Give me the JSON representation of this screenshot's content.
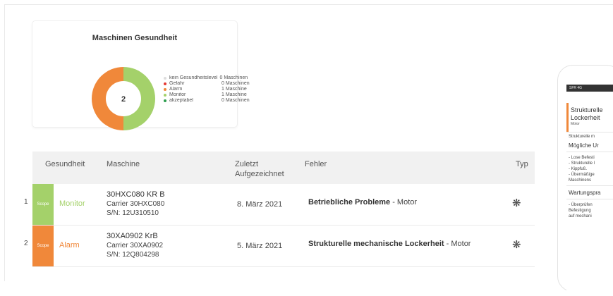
{
  "health_card": {
    "title": "Maschinen Gesundheit",
    "center_value": "2",
    "colors": {
      "alarm": "#f0883a",
      "monitor": "#a4d16a",
      "danger": "#e53935",
      "acceptable": "#2e9e4f",
      "none": "#dddddd"
    },
    "legend": [
      {
        "label": "kein Gesundheitslevel",
        "value": "0 Maschinen",
        "color": "#dddddd"
      },
      {
        "label": "Gefahr",
        "value": "0 Maschinen",
        "color": "#e53935"
      },
      {
        "label": "Alarm",
        "value": "1 Maschine",
        "color": "#f0883a"
      },
      {
        "label": "Monitor",
        "value": "1 Maschine",
        "color": "#a4d16a"
      },
      {
        "label": "akzeptabel",
        "value": "0 Maschinen",
        "color": "#2e9e4f"
      }
    ],
    "donut_split": {
      "alarm": 1,
      "monitor": 1
    }
  },
  "table": {
    "headers": {
      "health": "Gesundheit",
      "machine": "Maschine",
      "last_recorded_1": "Zuletzt",
      "last_recorded_2": "Aufgezeichnet",
      "fault": "Fehler",
      "type": "Typ"
    },
    "rows": [
      {
        "num": "1",
        "scope": "Scope",
        "status": "Monitor",
        "status_color": "#a4d16a",
        "machine_name": "30HXC080 KR B",
        "carrier": "Carrier  30HXC080",
        "serial": "S/N: 12U310510",
        "date": "8. März 2021",
        "fault_bold": "Betriebliche Probleme",
        "fault_rest": " - Motor",
        "type_icon": "snowflake-icon"
      },
      {
        "num": "2",
        "scope": "Scope",
        "status": "Alarm",
        "status_color": "#f0883a",
        "machine_name": "30XA0902 KrB",
        "carrier": "Carrier  30XA0902",
        "serial": "S/N: 12Q804298",
        "date": "5. März 2021",
        "fault_bold": "Strukturelle mechanische Lockerheit",
        "fault_rest": " - Motor",
        "type_icon": "snowflake-icon"
      }
    ]
  },
  "phone": {
    "status_bar": "SFR  4G",
    "title_1": "Strukturelle",
    "title_2": "Lockerheit",
    "subtitle": "Motor",
    "line_a": "Strukturelle m",
    "heading_a": "Mögliche Ur",
    "bullets": [
      "- Lose Befesti",
      "- Strukturelle l",
      "- Kippfuß.",
      "- Übermäßige",
      "Maschinens"
    ],
    "heading_b": "Wartungspra",
    "bullets_b": [
      "- Überprüfen",
      "Befestigung",
      "auf mechani"
    ]
  }
}
